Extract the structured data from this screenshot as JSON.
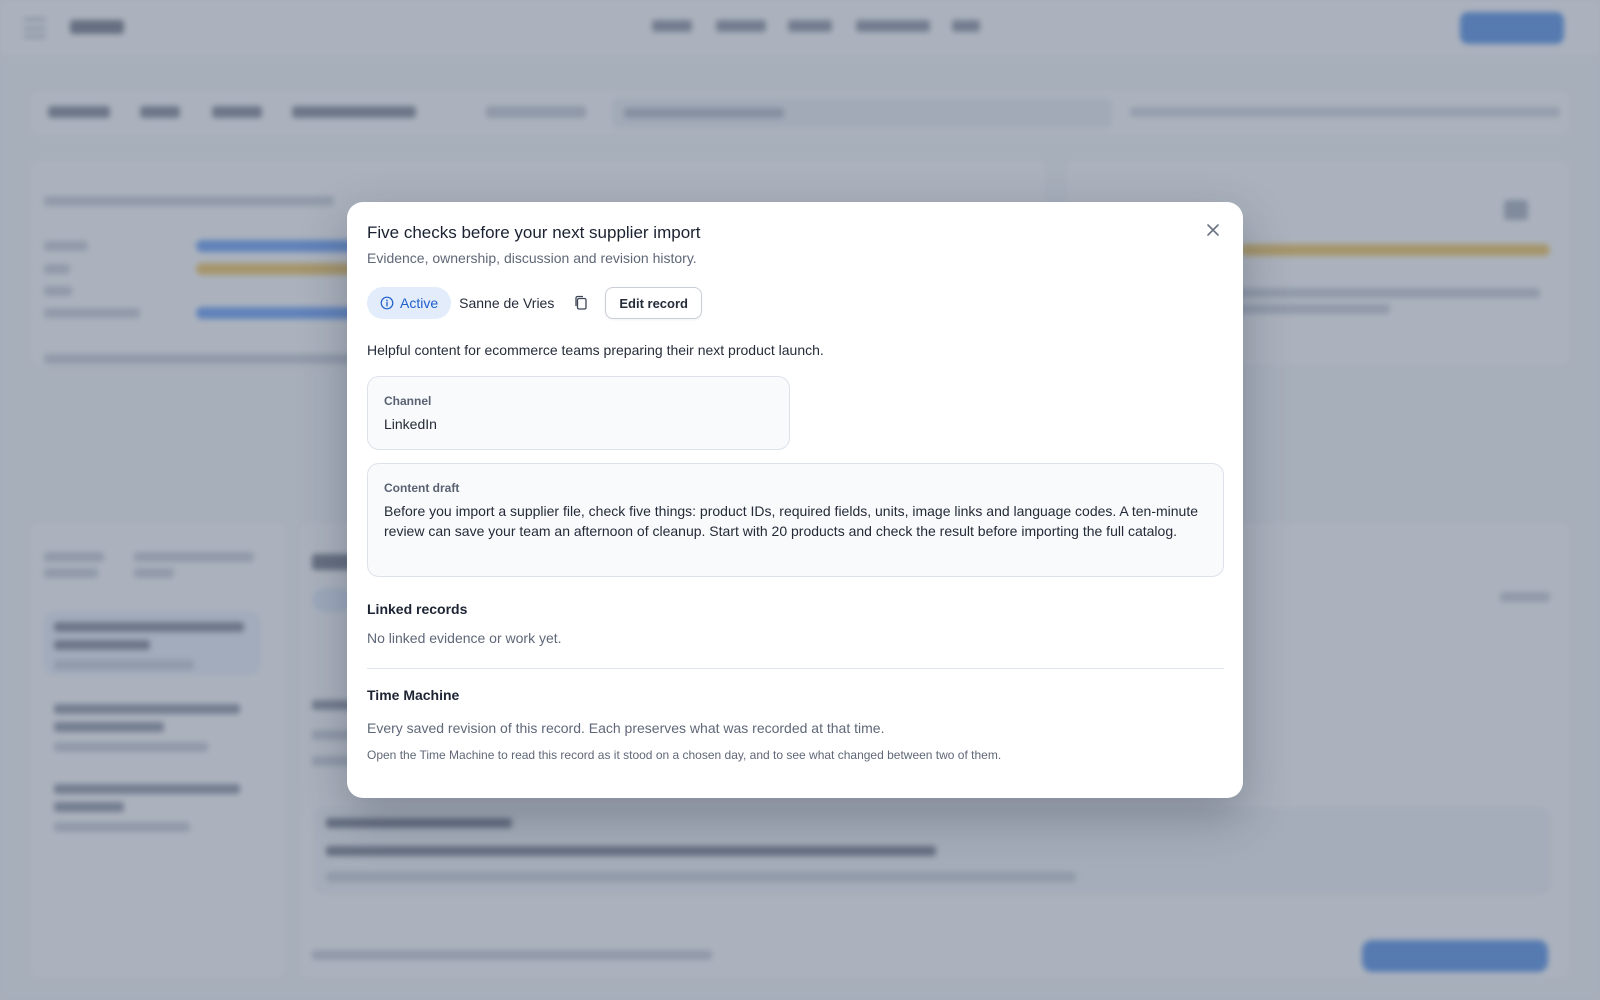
{
  "modal": {
    "title": "Five checks before your next supplier import",
    "subtitle": "Evidence, ownership, discussion and revision history.",
    "close_icon": "close-icon",
    "status": {
      "label": "Active",
      "icon": "info-icon",
      "color": "#1f5fc9"
    },
    "owner": "Sanne de Vries",
    "copy_icon": "copy-icon",
    "edit_button": "Edit record",
    "description": "Helpful content for ecommerce teams preparing their next product launch.",
    "channel": {
      "label": "Channel",
      "value": "LinkedIn"
    },
    "content_draft": {
      "label": "Content draft",
      "value": "Before you import a supplier file, check five things: product IDs, required fields, units, image links and language codes. A ten-minute review can save your team an afternoon of cleanup. Start with 20 products and check the result before importing the full catalog."
    },
    "linked_records": {
      "title": "Linked records",
      "empty_text": "No linked evidence or work yet."
    },
    "time_machine": {
      "title": "Time Machine",
      "description": "Every saved revision of this record. Each preserves what was recorded at that time.",
      "note": "Open the Time Machine to read this record as it stood on a chosen day, and to see what changed between two of them."
    }
  },
  "colors": {
    "accent": "#1f6fe0",
    "badge_bg": "#e2ecfb",
    "bar_blue": "#3b82f6",
    "bar_amber": "#f0b429"
  }
}
